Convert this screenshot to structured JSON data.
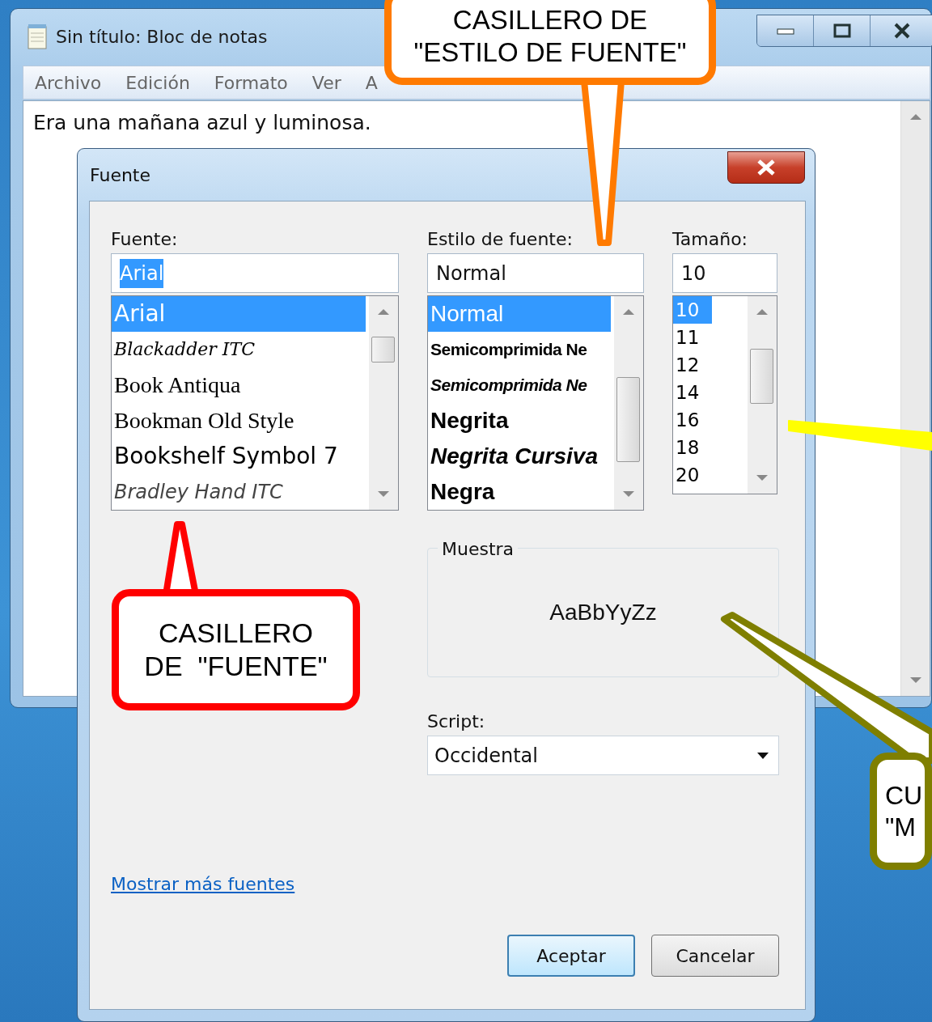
{
  "notepad": {
    "title": "Sin título: Bloc de notas",
    "menu": [
      {
        "label": "Archivo"
      },
      {
        "label": "Edición"
      },
      {
        "label": "Formato"
      },
      {
        "label": "Ver"
      },
      {
        "label": "A"
      }
    ],
    "text": "Era una mañana azul y luminosa."
  },
  "dialog": {
    "title": "Fuente",
    "font": {
      "label": "Fuente:",
      "value": "Arial",
      "items": [
        {
          "label": "Arial",
          "selected": true
        },
        {
          "label": "Blackadder ITC",
          "selected": false
        },
        {
          "label": "Book Antiqua",
          "selected": false
        },
        {
          "label": "Bookman Old Style",
          "selected": false
        },
        {
          "label": "Bookshelf Symbol 7",
          "selected": false
        },
        {
          "label": "Bradley Hand ITC",
          "selected": false
        }
      ]
    },
    "style": {
      "label": "Estilo de fuente:",
      "value": "Normal",
      "items": [
        {
          "label": "Normal",
          "selected": true
        },
        {
          "label": "Semicomprimida Ne",
          "selected": false
        },
        {
          "label": "Semicomprimida Ne",
          "selected": false
        },
        {
          "label": "Negrita",
          "selected": false
        },
        {
          "label": "Negrita Cursiva",
          "selected": false
        },
        {
          "label": "Negra",
          "selected": false
        }
      ]
    },
    "size": {
      "label": "Tamaño:",
      "value": "10",
      "items": [
        {
          "label": "10",
          "selected": true
        },
        {
          "label": "11",
          "selected": false
        },
        {
          "label": "12",
          "selected": false
        },
        {
          "label": "14",
          "selected": false
        },
        {
          "label": "16",
          "selected": false
        },
        {
          "label": "18",
          "selected": false
        },
        {
          "label": "20",
          "selected": false
        }
      ]
    },
    "sample": {
      "legend": "Muestra",
      "text": "AaBbYyZz"
    },
    "script": {
      "label": "Script:",
      "value": "Occidental"
    },
    "link": "Mostrar más fuentes",
    "buttons": [
      {
        "label": "Aceptar",
        "default": true
      },
      {
        "label": "Cancelar",
        "default": false
      }
    ]
  },
  "callouts": [
    {
      "text": "CASILLERO DE\n\"ESTILO DE FUENTE\"",
      "color": "#ff7a00"
    },
    {
      "text": "CASILLERO\nDE  \"FUENTE\"",
      "color": "#ff0000"
    },
    {
      "color": "#ffff00"
    },
    {
      "text": "CU\n\"M",
      "color": "#7f7f00"
    }
  ]
}
